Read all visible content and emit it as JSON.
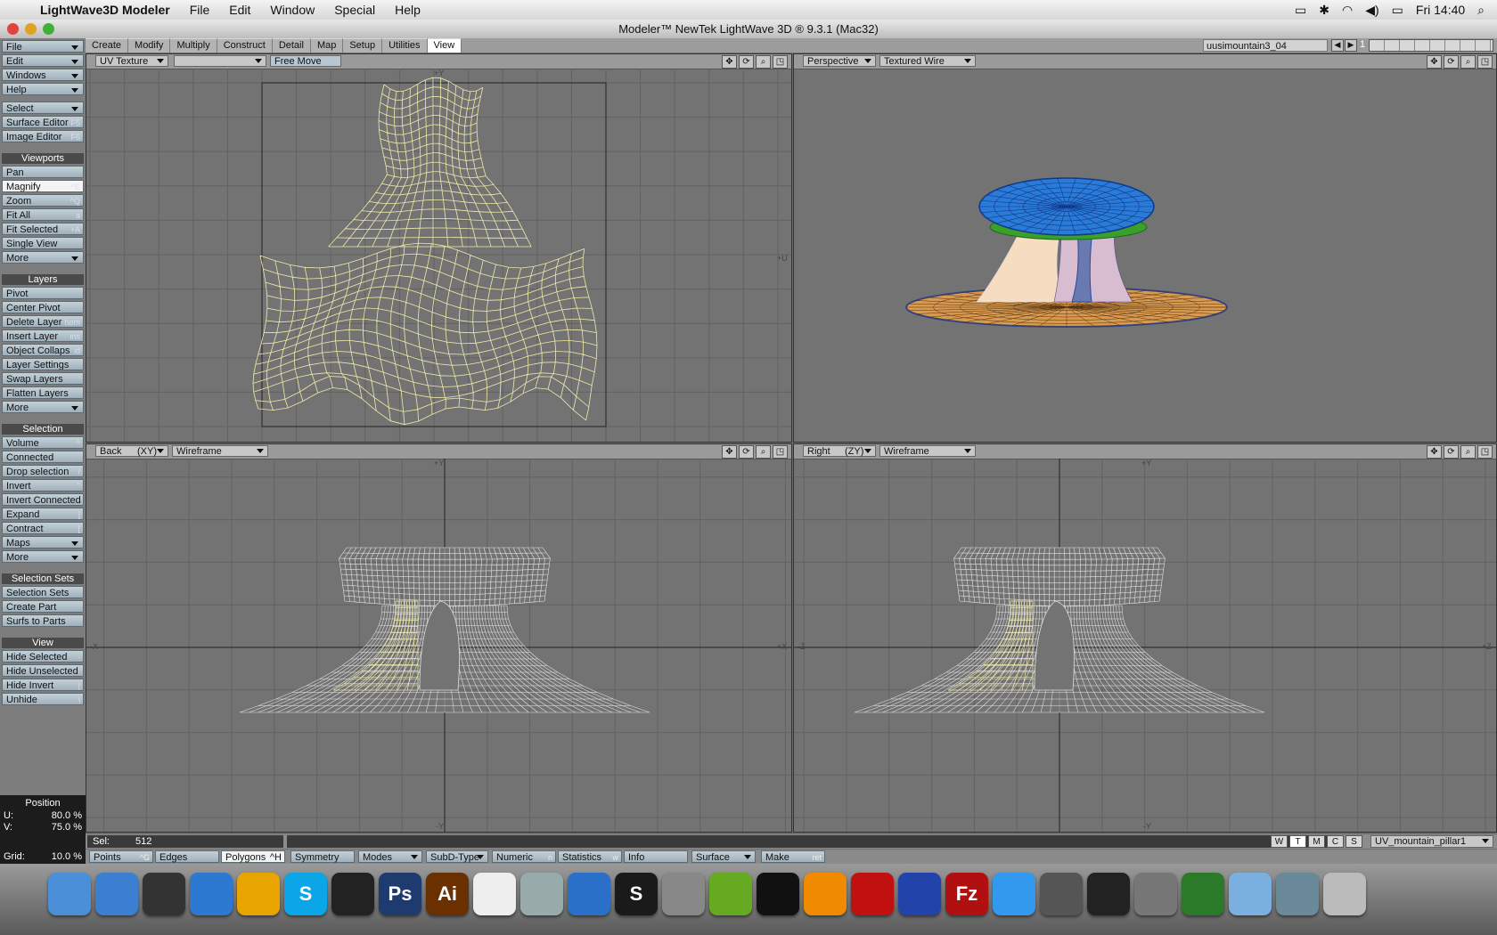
{
  "menubar": {
    "app": "LightWave3D Modeler",
    "items": [
      "File",
      "Edit",
      "Window",
      "Special",
      "Help"
    ],
    "clock": "Fri 14:40"
  },
  "window": {
    "title": "Modeler™ NewTek LightWave 3D ® 9.3.1 (Mac32)"
  },
  "tabs": [
    "Create",
    "Modify",
    "Multiply",
    "Construct",
    "Detail",
    "Map",
    "Setup",
    "Utilities",
    "View"
  ],
  "active_tab": "View",
  "layer_selector": "uusimountain3_04",
  "layer_number": "1",
  "left_panel": {
    "top": [
      "File",
      "Edit",
      "Windows",
      "Help"
    ],
    "select": "Select",
    "surface_editor": {
      "label": "Surface Editor",
      "shortcut": "F5"
    },
    "image_editor": {
      "label": "Image Editor",
      "shortcut": "F6"
    },
    "viewports_header": "Viewports",
    "viewports": [
      {
        "label": "Pan",
        "shortcut": ""
      },
      {
        "label": "Magnify",
        "shortcut": "^E"
      },
      {
        "label": "Zoom",
        "shortcut": "^Q"
      },
      {
        "label": "Fit All",
        "shortcut": "a"
      },
      {
        "label": "Fit Selected",
        "shortcut": "+A"
      },
      {
        "label": "Single View",
        "shortcut": ""
      },
      {
        "label": "More",
        "shortcut": ""
      }
    ],
    "layers_header": "Layers",
    "layers": [
      {
        "label": "Pivot",
        "shortcut": ""
      },
      {
        "label": "Center Pivot",
        "shortcut": ""
      },
      {
        "label": "Delete Layer",
        "shortcut": "hom"
      },
      {
        "label": "Insert Layer",
        "shortcut": "ins"
      },
      {
        "label": "Object Collaps",
        "shortcut": "id"
      },
      {
        "label": "Layer Settings",
        "shortcut": ""
      },
      {
        "label": "Swap Layers",
        "shortcut": "'"
      },
      {
        "label": "Flatten Layers",
        "shortcut": ""
      },
      {
        "label": "More",
        "shortcut": ""
      }
    ],
    "selection_header": "Selection",
    "selection": [
      {
        "label": "Volume",
        "shortcut": "^"
      },
      {
        "label": "Connected",
        "shortcut": ""
      },
      {
        "label": "Drop selection",
        "shortcut": "/"
      },
      {
        "label": "Invert",
        "shortcut": "\""
      },
      {
        "label": "Invert Connected",
        "shortcut": ""
      },
      {
        "label": "Expand",
        "shortcut": "]"
      },
      {
        "label": "Contract",
        "shortcut": "["
      },
      {
        "label": "Maps",
        "shortcut": ""
      },
      {
        "label": "More",
        "shortcut": ""
      }
    ],
    "selsets_header": "Selection Sets",
    "selsets": [
      {
        "label": "Selection Sets",
        "shortcut": ""
      },
      {
        "label": "Create Part",
        "shortcut": ""
      },
      {
        "label": "Surfs to Parts",
        "shortcut": ""
      }
    ],
    "view_header": "View",
    "view": [
      {
        "label": "Hide Selected",
        "shortcut": "-"
      },
      {
        "label": "Hide Unselected",
        "shortcut": ""
      },
      {
        "label": "Hide Invert",
        "shortcut": "|"
      },
      {
        "label": "Unhide",
        "shortcut": "\\"
      }
    ]
  },
  "position": {
    "header": "Position",
    "u_label": "U:",
    "u": "80.0 %",
    "v_label": "V:",
    "v": "75.0 %"
  },
  "grid": {
    "label": "Grid:",
    "value": "10.0 %"
  },
  "viewports": {
    "uv": {
      "mode": "UV Texture",
      "map": "",
      "tool": "Free Move",
      "axis_v": "+Y",
      "axis_u": "+U"
    },
    "persp": {
      "view": "Perspective",
      "shade": "Textured Wire"
    },
    "back": {
      "view": "Back",
      "axis": "(XY)",
      "shade": "Wireframe",
      "pos_y": "+Y",
      "neg_y": "-Y",
      "pos_x": "+X",
      "neg_x": "-X"
    },
    "right": {
      "view": "Right",
      "axis": "(ZY)",
      "shade": "Wireframe",
      "pos_y": "+Y",
      "neg_y": "-Y",
      "pos_z": "+Z",
      "neg_z": "-Z"
    }
  },
  "status": {
    "sel_label": "Sel:",
    "sel_value": "512"
  },
  "mode_buttons": {
    "points": "Points",
    "points_sc": "^G",
    "edges": "Edges",
    "polygons": "Polygons",
    "polygons_sc": "^H",
    "symmetry": "Symmetry",
    "modes": "Modes",
    "subd": "SubD-Type",
    "numeric": "Numeric",
    "numeric_sc": "n",
    "statistics": "Statistics",
    "statistics_sc": "w",
    "info": "Info",
    "surface": "Surface",
    "make": "Make",
    "make_sc": "ret"
  },
  "wtmcs": [
    "W",
    "T",
    "M",
    "C",
    "S"
  ],
  "vmap": "UV_mountain_pillar1",
  "dock_icons": [
    "finder-icon",
    "ichat-icon",
    "dashboard-icon",
    "safari-icon",
    "bridge-icon",
    "skype-icon",
    "itunes-remote-icon",
    "photoshop-icon",
    "illustrator-icon",
    "textedit-icon",
    "preview-icon",
    "vortex-icon",
    "scrivener-icon",
    "automator-icon",
    "messages-icon",
    "terminal-icon",
    "vlc-icon",
    "lightwave-icon",
    "layout-icon",
    "filezilla-icon",
    "itunes-icon",
    "iphoto-icon",
    "imovie-icon",
    "system-prefs-icon",
    "lightwave-modeler-icon",
    "folder-icon",
    "documents-icon",
    "trash-icon"
  ],
  "dock_labels": {
    "photoshop": "Ps",
    "illustrator": "Ai",
    "skype": "S",
    "scrivener": "S",
    "filezilla": "Fz"
  },
  "colors": {
    "uv_wire": "#f0eba8",
    "panel_button": "#b3c2cc",
    "viewport_bg": "#737373"
  }
}
